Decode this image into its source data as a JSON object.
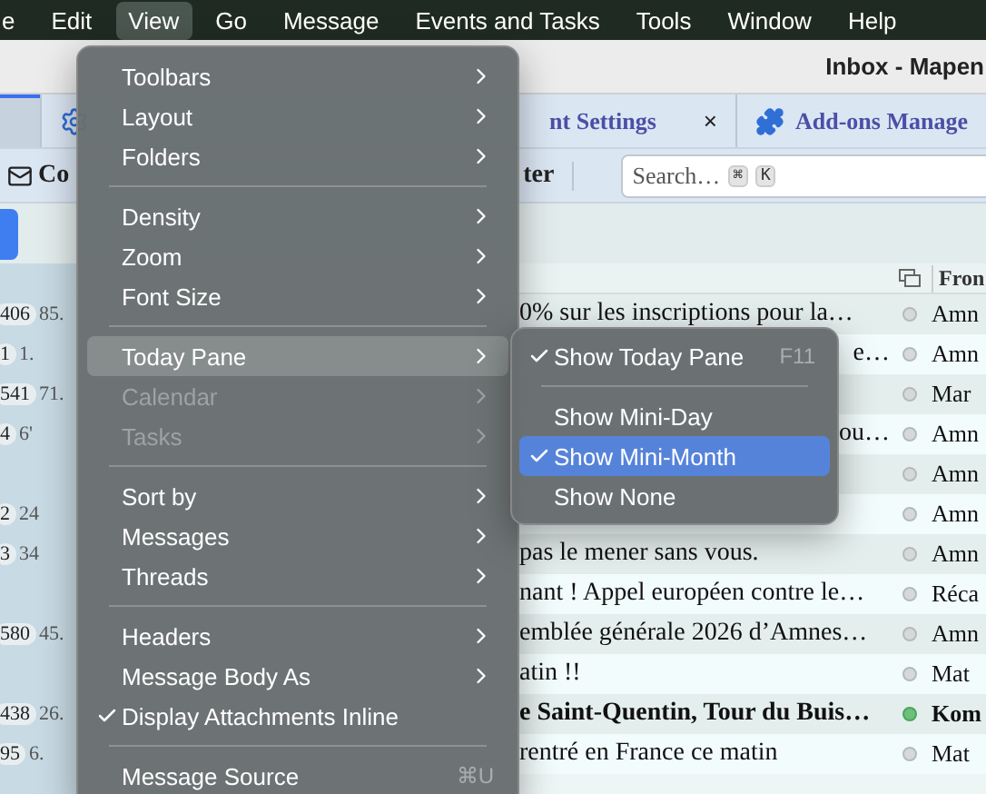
{
  "menubar": [
    {
      "label": "e",
      "selected": false
    },
    {
      "label": "Edit",
      "selected": false
    },
    {
      "label": "View",
      "selected": true
    },
    {
      "label": "Go",
      "selected": false
    },
    {
      "label": "Message",
      "selected": false
    },
    {
      "label": "Events and Tasks",
      "selected": false
    },
    {
      "label": "Tools",
      "selected": false
    },
    {
      "label": "Window",
      "selected": false
    },
    {
      "label": "Help",
      "selected": false
    }
  ],
  "window": {
    "title": "Inbox - Mapen"
  },
  "tabs": [
    {
      "label": "nt Settings",
      "close": "×",
      "selected": false
    },
    {
      "label": "Add-ons Manage",
      "selected": false
    }
  ],
  "toolbar": {
    "compose": "Co",
    "filter": "ter",
    "search": {
      "placeholder": "Search…",
      "keys": [
        "⌘",
        "K"
      ]
    }
  },
  "columns": {
    "from": "Fron"
  },
  "folders": [
    {
      "kind": "folder",
      "count": "406",
      "size": "85."
    },
    {
      "kind": "folder",
      "count": "1",
      "size": "1."
    },
    {
      "kind": "folder",
      "count": "541",
      "size": "71."
    },
    {
      "kind": "folder",
      "count": "4",
      "size": "6'"
    },
    {
      "kind": "spacer"
    },
    {
      "kind": "folder",
      "count": "2",
      "size": "24"
    },
    {
      "kind": "folder",
      "count": "3",
      "size": "34"
    },
    {
      "kind": "spacer"
    },
    {
      "kind": "folder",
      "count": "580",
      "size": "45."
    },
    {
      "kind": "spacer"
    },
    {
      "kind": "folder",
      "count": "438",
      "size": "26."
    },
    {
      "kind": "folder",
      "count": "95",
      "size": "6."
    }
  ],
  "messages": [
    {
      "kind": "full",
      "subject": "0% sur les inscriptions pour la…",
      "from": "Amn",
      "unread": false
    },
    {
      "kind": "partial",
      "subject": "e…",
      "from": "Amn",
      "unread": false
    },
    {
      "kind": "hidden",
      "from": "Mar",
      "unread": false
    },
    {
      "kind": "partial",
      "subject": "ou…",
      "from": "Amn",
      "unread": false
    },
    {
      "kind": "hidden",
      "from": "Amn",
      "unread": false
    },
    {
      "kind": "hidden",
      "from": "Amn",
      "unread": false
    },
    {
      "kind": "full",
      "subject": "pas le mener sans vous.",
      "from": "Amn",
      "unread": false
    },
    {
      "kind": "full",
      "subject": "nant ! Appel européen contre le…",
      "from": "Réca",
      "unread": false
    },
    {
      "kind": "full",
      "subject": "emblée générale 2026 d’Amnes…",
      "from": "Amn",
      "unread": false
    },
    {
      "kind": "full",
      "subject": "atin !!",
      "from": "Mat",
      "unread": false
    },
    {
      "kind": "full",
      "subject": "e Saint-Quentin, Tour du Buis…",
      "from": "Kom",
      "unread": true
    },
    {
      "kind": "full",
      "subject": "rentré en France ce matin",
      "from": "Mat",
      "unread": false
    }
  ],
  "menu": [
    {
      "kind": "item",
      "label": "Toolbars",
      "submenu": true,
      "disabled": false,
      "checked": false,
      "selected": false
    },
    {
      "kind": "item",
      "label": "Layout",
      "submenu": true,
      "disabled": false,
      "checked": false,
      "selected": false
    },
    {
      "kind": "item",
      "label": "Folders",
      "submenu": true,
      "disabled": false,
      "checked": false,
      "selected": false
    },
    {
      "kind": "separator"
    },
    {
      "kind": "item",
      "label": "Density",
      "submenu": true,
      "disabled": false,
      "checked": false,
      "selected": false
    },
    {
      "kind": "item",
      "label": "Zoom",
      "submenu": true,
      "disabled": false,
      "checked": false,
      "selected": false
    },
    {
      "kind": "item",
      "label": "Font Size",
      "submenu": true,
      "disabled": false,
      "checked": false,
      "selected": false
    },
    {
      "kind": "separator"
    },
    {
      "kind": "item",
      "label": "Today Pane",
      "submenu": true,
      "disabled": false,
      "checked": false,
      "selected": true
    },
    {
      "kind": "item",
      "label": "Calendar",
      "submenu": true,
      "disabled": true,
      "checked": false,
      "selected": false
    },
    {
      "kind": "item",
      "label": "Tasks",
      "submenu": true,
      "disabled": true,
      "checked": false,
      "selected": false
    },
    {
      "kind": "separator"
    },
    {
      "kind": "item",
      "label": "Sort by",
      "submenu": true,
      "disabled": false,
      "checked": false,
      "selected": false
    },
    {
      "kind": "item",
      "label": "Messages",
      "submenu": true,
      "disabled": false,
      "checked": false,
      "selected": false
    },
    {
      "kind": "item",
      "label": "Threads",
      "submenu": true,
      "disabled": false,
      "checked": false,
      "selected": false
    },
    {
      "kind": "separator"
    },
    {
      "kind": "item",
      "label": "Headers",
      "submenu": true,
      "disabled": false,
      "checked": false,
      "selected": false
    },
    {
      "kind": "item",
      "label": "Message Body As",
      "submenu": true,
      "disabled": false,
      "checked": false,
      "selected": false
    },
    {
      "kind": "item",
      "label": "Display Attachments Inline",
      "submenu": false,
      "disabled": false,
      "checked": true,
      "selected": false
    },
    {
      "kind": "separator"
    },
    {
      "kind": "item",
      "label": "Message Source",
      "submenu": false,
      "disabled": false,
      "checked": false,
      "selected": false,
      "shortcut": "⌘U"
    }
  ],
  "submenu": [
    {
      "kind": "item",
      "label": "Show Today Pane",
      "checked": true,
      "selected": false,
      "shortcut": "F11"
    },
    {
      "kind": "separator"
    },
    {
      "kind": "item",
      "label": "Show Mini-Day",
      "checked": false,
      "selected": false
    },
    {
      "kind": "item",
      "label": "Show Mini-Month",
      "checked": true,
      "selected": true
    },
    {
      "kind": "item",
      "label": "Show None",
      "checked": false,
      "selected": false
    }
  ]
}
